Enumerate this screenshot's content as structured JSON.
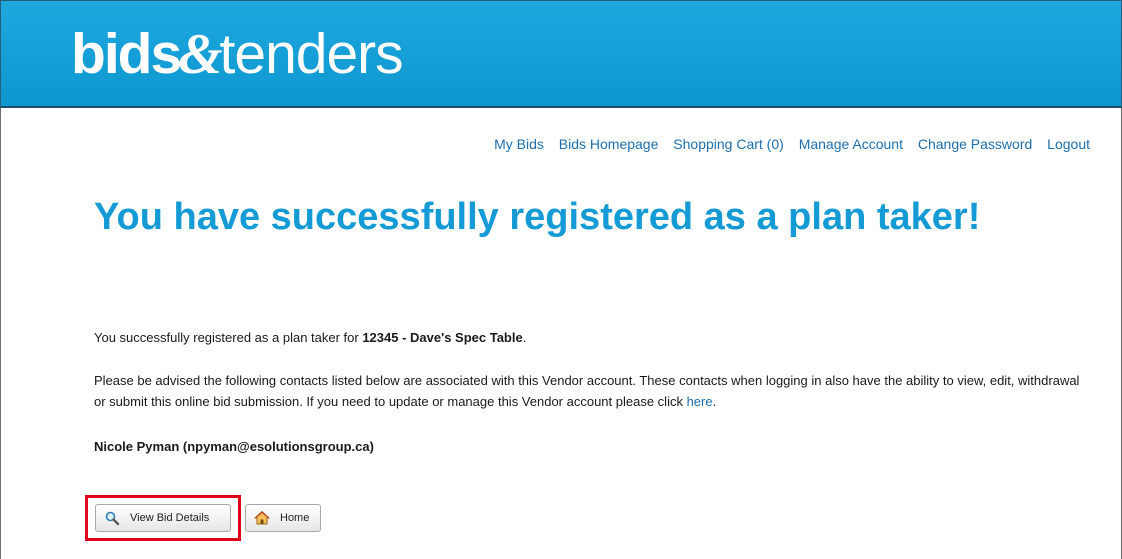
{
  "header": {
    "logo": {
      "part1": "bids",
      "amp": "&",
      "part2": "tenders"
    }
  },
  "nav": {
    "items": [
      {
        "label": "My Bids"
      },
      {
        "label": "Bids Homepage"
      },
      {
        "label": "Shopping Cart (0)"
      },
      {
        "label": "Manage Account"
      },
      {
        "label": "Change Password"
      },
      {
        "label": "Logout"
      }
    ]
  },
  "main": {
    "title": "You have successfully registered as a plan taker!",
    "registered": {
      "text": "You successfully registered as a plan taker for ",
      "bid": "12345 - Dave's Spec Table",
      "end": "."
    },
    "advisory": {
      "text": "Please be advised the following contacts listed below are associated with this Vendor account.  These contacts when logging in also have the ability to view, edit, withdrawal or submit this online bid submission.  If you need to update or manage this Vendor account please click ",
      "link": "here",
      "end": "."
    },
    "contact": "Nicole Pyman (npyman@esolutionsgroup.ca)"
  },
  "buttons": {
    "view_bid_details": {
      "label": "View Bid Details",
      "icon": "magnifier-icon"
    },
    "home": {
      "label": "Home",
      "icon": "home-icon"
    }
  },
  "colors": {
    "header": "#0d97d0",
    "title": "#149bd5",
    "link": "#1f6fad",
    "highlight": "#e0001b"
  }
}
